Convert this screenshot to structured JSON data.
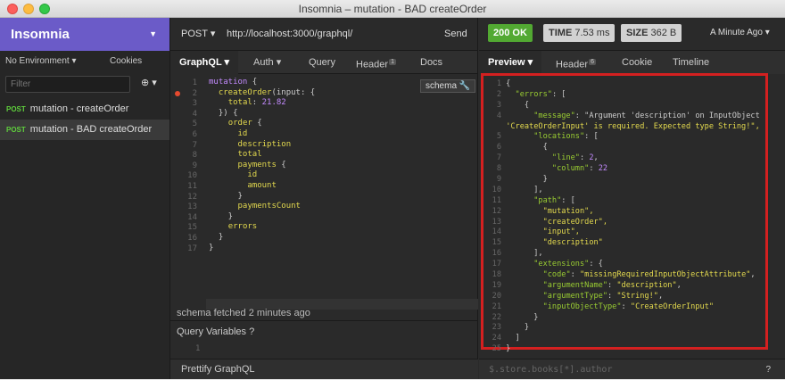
{
  "window": {
    "title": "Insomnia – mutation - BAD createOrder"
  },
  "sidebar": {
    "brand": "Insomnia",
    "environment": "No Environment",
    "cookies": "Cookies",
    "filter_placeholder": "Filter",
    "requests": [
      {
        "method": "POST",
        "name": "mutation - createOrder",
        "active": false
      },
      {
        "method": "POST",
        "name": "mutation - BAD createOrder",
        "active": true
      }
    ]
  },
  "request": {
    "method": "POST",
    "url": "http://localhost:3000/graphql/",
    "send": "Send",
    "tabs": {
      "body": "GraphQL",
      "auth": "Auth",
      "query": "Query",
      "header": "Header",
      "header_count": "1",
      "docs": "Docs"
    },
    "schema_button": "schema",
    "code": [
      "mutation {",
      "  createOrder(input: {",
      "    total: 21.82",
      "  }) {",
      "    order {",
      "      id",
      "      description",
      "      total",
      "      payments {",
      "        id",
      "        amount",
      "      }",
      "      paymentsCount",
      "    }",
      "    errors",
      "  }",
      "}"
    ],
    "schema_status": "schema fetched 2 minutes ago",
    "query_variables": "Query Variables",
    "prettify": "Prettify GraphQL"
  },
  "response": {
    "status": "200 OK",
    "time_label": "TIME",
    "time_value": "7.53 ms",
    "size_label": "SIZE",
    "size_value": "362 B",
    "when": "A Minute Ago",
    "tabs": {
      "preview": "Preview",
      "header": "Header",
      "header_count": "6",
      "cookie": "Cookie",
      "timeline": "Timeline"
    },
    "json_lines": [
      "{",
      "  \"errors\": [",
      "    {",
      "      \"message\": \"Argument 'description' on InputObject",
      "'CreateOrderInput' is required. Expected type String!\",",
      "      \"locations\": [",
      "        {",
      "          \"line\": 2,",
      "          \"column\": 22",
      "        }",
      "      ],",
      "      \"path\": [",
      "        \"mutation\",",
      "        \"createOrder\",",
      "        \"input\",",
      "        \"description\"",
      "      ],",
      "      \"extensions\": {",
      "        \"code\": \"missingRequiredInputObjectAttribute\",",
      "        \"argumentName\": \"description\",",
      "        \"argumentType\": \"String!\",",
      "        \"inputObjectType\": \"CreateOrderInput\"",
      "      }",
      "    }",
      "  ]",
      "}"
    ],
    "filter_placeholder": "$.store.books[*].author",
    "help": "?"
  }
}
